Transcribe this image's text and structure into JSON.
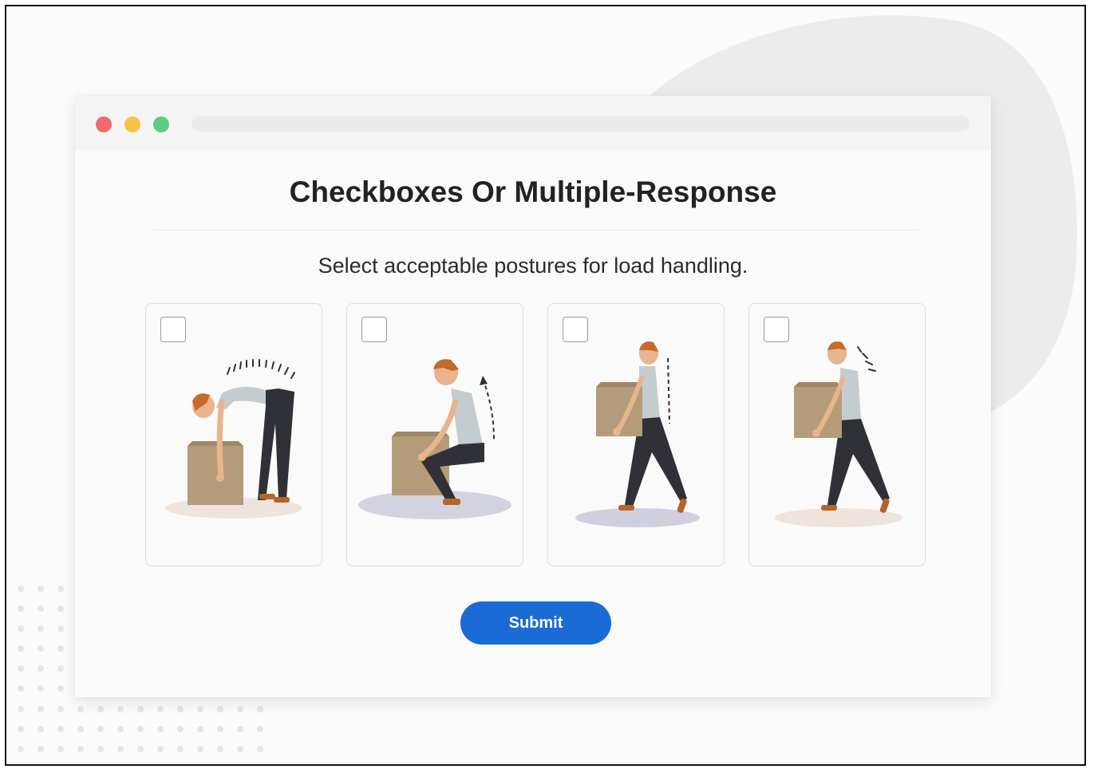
{
  "page": {
    "heading": "Checkboxes Or Multiple-Response",
    "prompt": "Select acceptable postures for load handling."
  },
  "window_controls": [
    {
      "name": "close",
      "color": "#f06b6b"
    },
    {
      "name": "minimize",
      "color": "#f7c44a"
    },
    {
      "name": "maximize",
      "color": "#5ccb83"
    }
  ],
  "options": [
    {
      "id": "bent-over-lift",
      "checked": false
    },
    {
      "id": "squat-lift",
      "checked": false
    },
    {
      "id": "upright-carry",
      "checked": false
    },
    {
      "id": "hunched-carry",
      "checked": false
    }
  ],
  "submit": {
    "label": "Submit",
    "color": "#1a6bd6"
  }
}
